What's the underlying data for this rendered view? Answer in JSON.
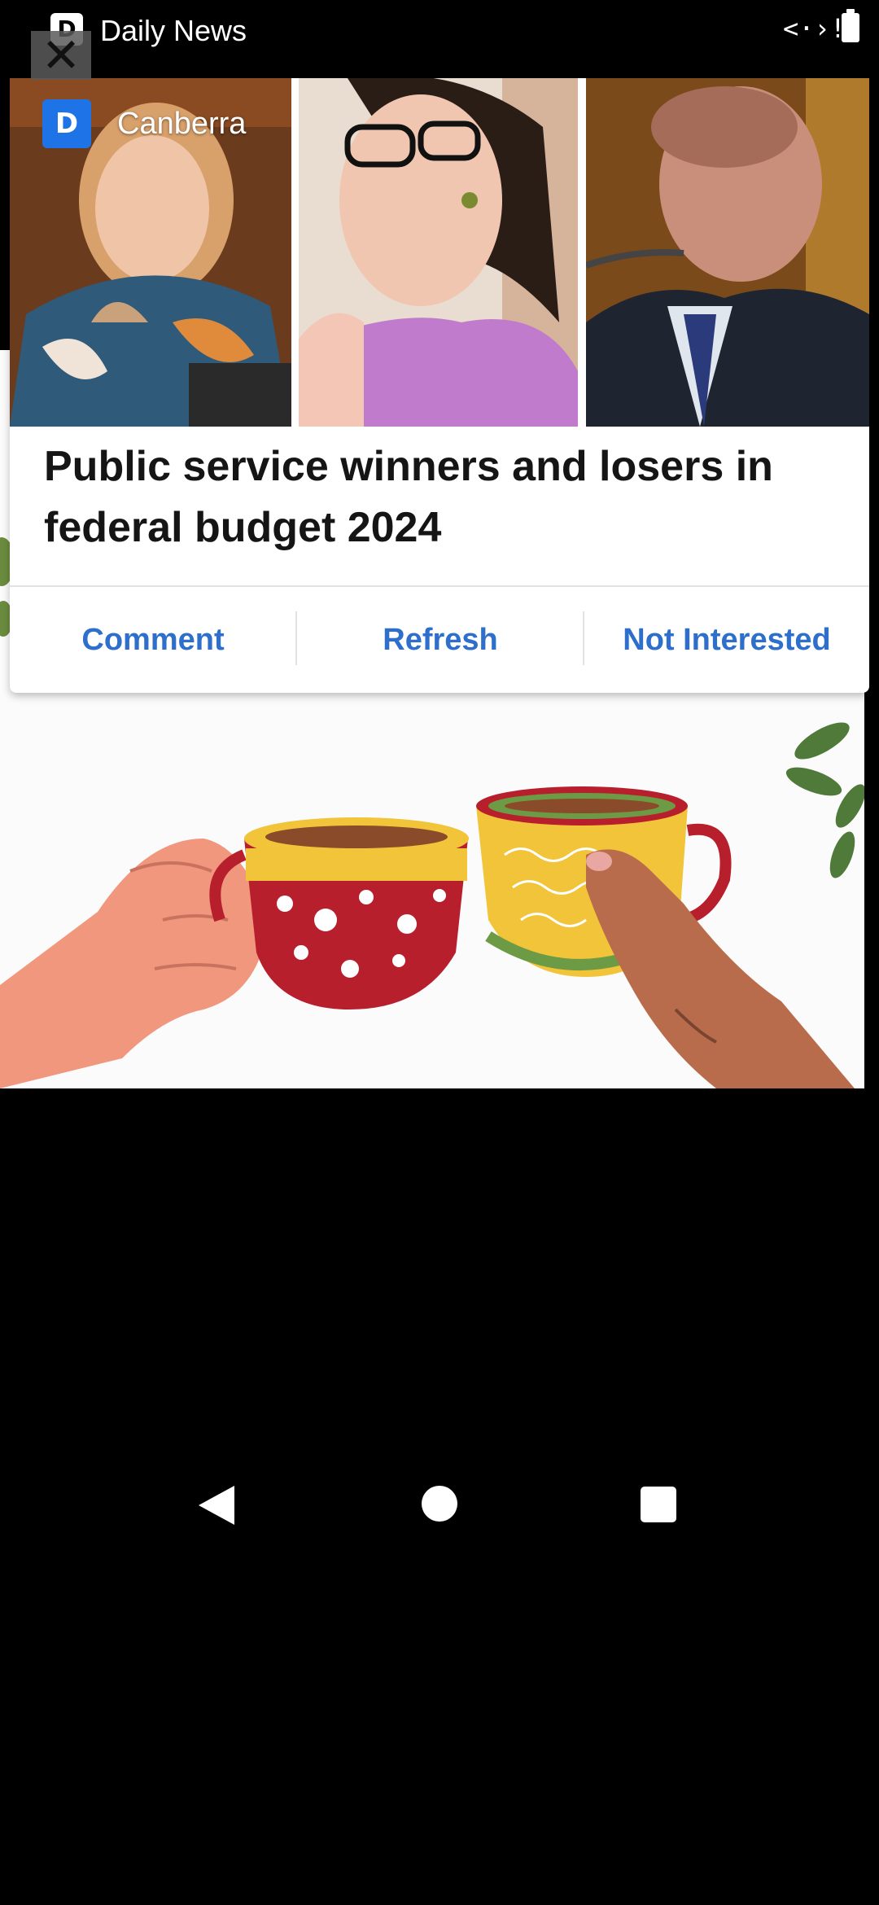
{
  "status_bar": {
    "app_name": "Daily News",
    "app_icon_letter": "D",
    "net_icon_glyph": "<·›!"
  },
  "ad": {
    "close_glyph": "✕"
  },
  "card": {
    "source_logo_letter": "D",
    "source_name": "Canberra",
    "headline": "Public service winners and losers in federal budget 2024",
    "actions": [
      "Comment",
      "Refresh",
      "Not Interested"
    ]
  },
  "colors": {
    "accent": "#2d6fcb",
    "logo_blue": "#1e73e6"
  },
  "icons": [
    "app-icon",
    "network-icon",
    "battery-icon",
    "close-icon",
    "back-icon",
    "home-icon",
    "recents-icon"
  ]
}
